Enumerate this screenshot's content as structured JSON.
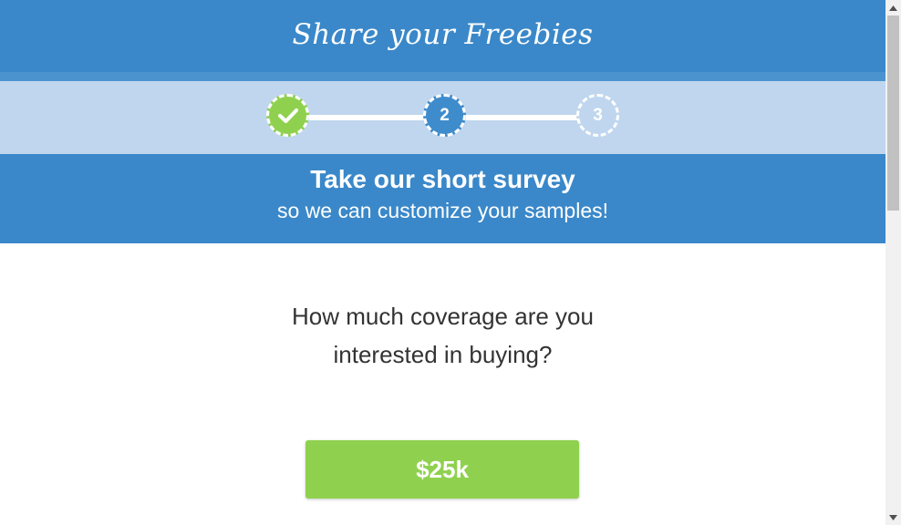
{
  "brand": {
    "title": "Share your Freebies",
    "color": "#3a88c9"
  },
  "progress": {
    "steps": [
      {
        "label": "",
        "state": "completed",
        "icon": "check-icon"
      },
      {
        "label": "2",
        "state": "current"
      },
      {
        "label": "3",
        "state": "upcoming"
      }
    ],
    "colors": {
      "completed": "#8fd14f",
      "current": "#3f8ccc",
      "band": "#bfd6ee"
    }
  },
  "survey": {
    "title": "Take our short survey",
    "subtitle": "so we can customize your samples!"
  },
  "question": {
    "text": "How much coverage are you interested in buying?",
    "options": [
      {
        "label": "$25k"
      }
    ],
    "option_color": "#8fd14f"
  }
}
